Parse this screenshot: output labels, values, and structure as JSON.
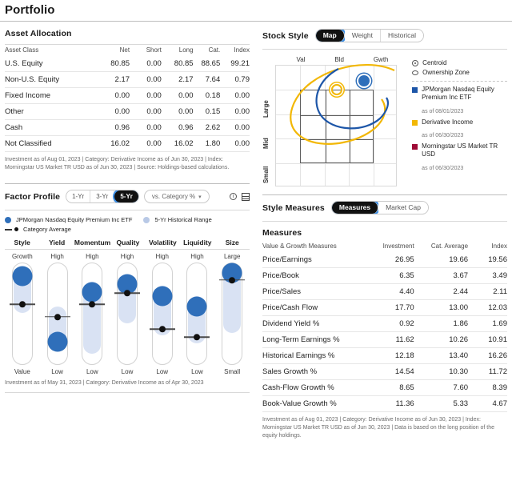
{
  "page": {
    "title": "Portfolio"
  },
  "asset_allocation": {
    "title": "Asset Allocation",
    "columns": [
      "Asset Class",
      "Net",
      "Short",
      "Long",
      "Cat.",
      "Index"
    ],
    "rows": [
      {
        "label": "U.S. Equity",
        "net": "80.85",
        "short": "0.00",
        "long": "80.85",
        "cat": "88.65",
        "index": "99.21"
      },
      {
        "label": "Non-U.S. Equity",
        "net": "2.17",
        "short": "0.00",
        "long": "2.17",
        "cat": "7.64",
        "index": "0.79"
      },
      {
        "label": "Fixed Income",
        "net": "0.00",
        "short": "0.00",
        "long": "0.00",
        "cat": "0.18",
        "index": "0.00"
      },
      {
        "label": "Other",
        "net": "0.00",
        "short": "0.00",
        "long": "0.00",
        "cat": "0.15",
        "index": "0.00"
      },
      {
        "label": "Cash",
        "net": "0.96",
        "short": "0.00",
        "long": "0.96",
        "cat": "2.62",
        "index": "0.00"
      },
      {
        "label": "Not Classified",
        "net": "16.02",
        "short": "0.00",
        "long": "16.02",
        "cat": "1.80",
        "index": "0.00"
      }
    ],
    "footnote": "Investment as of Aug 01, 2023 | Category: Derivative Income as of Jun 30, 2023 | Index: Morningstar US Market TR USD as of Jun 30, 2023 | Source: Holdings-based calculations."
  },
  "stock_style": {
    "title": "Stock Style",
    "tabs": [
      {
        "label": "Map",
        "selected": true
      },
      {
        "label": "Weight",
        "selected": false
      },
      {
        "label": "Historical",
        "selected": false
      }
    ],
    "x_axis": [
      "Val",
      "Bld",
      "Gwth"
    ],
    "y_axis": [
      "Large",
      "Mid",
      "Small"
    ],
    "legend_markers": [
      {
        "label": "Centroid",
        "marker": "centroid-icon"
      },
      {
        "label": "Ownership Zone",
        "marker": "ownership-zone-icon"
      }
    ],
    "legend_series": [
      {
        "label": "JPMorgan Nasdaq Equity Premium Inc ETF",
        "asof": "as of 08/01/2023",
        "color": "#1d56a8"
      },
      {
        "label": "Derivative Income",
        "asof": "as of 06/30/2023",
        "color": "#f2b705"
      },
      {
        "label": "Morningstar US Market TR USD",
        "asof": "as of 06/30/2023",
        "color": "#9e0b36"
      }
    ]
  },
  "factor_profile": {
    "title": "Factor Profile",
    "tabs": [
      {
        "label": "1-Yr",
        "selected": false
      },
      {
        "label": "3-Yr",
        "selected": false
      },
      {
        "label": "5-Yr",
        "selected": true
      }
    ],
    "dropdown": "vs. Category %",
    "info_icon": "info-icon",
    "table_icon": "table-view-icon",
    "legend": [
      {
        "label": "JPMorgan Nasdaq Equity Premium Inc ETF",
        "color": "#2f6fba"
      },
      {
        "label": "5-Yr Historical Range",
        "color": "#b9c9e6"
      },
      {
        "label": "Category Average",
        "color": "#111111"
      }
    ],
    "footnote": "Investment as of May 31, 2023 | Category: Derivative Income as of Apr 30, 2023",
    "chart_data": {
      "type": "bar",
      "title": "Factor Profile",
      "categories": [
        "Style",
        "Yield",
        "Momentum",
        "Quality",
        "Volatility",
        "Liquidity",
        "Size"
      ],
      "top_labels": [
        "Growth",
        "High",
        "High",
        "High",
        "High",
        "High",
        "Large"
      ],
      "bottom_labels": [
        "Value",
        "Low",
        "Low",
        "Low",
        "Low",
        "Low",
        "Small"
      ],
      "ylim": [
        0,
        100
      ],
      "series": [
        {
          "name": "JPMorgan Nasdaq Equity Premium Inc ETF",
          "values": [
            88,
            24,
            72,
            80,
            68,
            58,
            91
          ]
        },
        {
          "name": "Category Average",
          "values": [
            60,
            48,
            60,
            71,
            36,
            28,
            84
          ]
        }
      ],
      "range_bands": [
        {
          "name": "Style",
          "low": 52,
          "high": 94
        },
        {
          "name": "Yield",
          "low": 18,
          "high": 58
        },
        {
          "name": "Momentum",
          "low": 12,
          "high": 82
        },
        {
          "name": "Quality",
          "low": 42,
          "high": 88
        },
        {
          "name": "Volatility",
          "low": 30,
          "high": 78
        },
        {
          "name": "Liquidity",
          "low": 22,
          "high": 68
        },
        {
          "name": "Size",
          "low": 32,
          "high": 93
        }
      ]
    }
  },
  "style_measures": {
    "title": "Style Measures",
    "tabs": [
      {
        "label": "Measures",
        "selected": true
      },
      {
        "label": "Market Cap",
        "selected": false
      }
    ],
    "subtitle": "Measures",
    "columns": [
      "Value & Growth Measures",
      "Investment",
      "Cat. Average",
      "Index"
    ],
    "rows": [
      {
        "label": "Price/Earnings",
        "investment": "26.95",
        "cat": "19.66",
        "index": "19.56"
      },
      {
        "label": "Price/Book",
        "investment": "6.35",
        "cat": "3.67",
        "index": "3.49"
      },
      {
        "label": "Price/Sales",
        "investment": "4.40",
        "cat": "2.44",
        "index": "2.11"
      },
      {
        "label": "Price/Cash Flow",
        "investment": "17.70",
        "cat": "13.00",
        "index": "12.03"
      },
      {
        "label": "Dividend Yield %",
        "investment": "0.92",
        "cat": "1.86",
        "index": "1.69"
      },
      {
        "label": "Long-Term Earnings %",
        "investment": "11.62",
        "cat": "10.26",
        "index": "10.91"
      },
      {
        "label": "Historical Earnings %",
        "investment": "12.18",
        "cat": "13.40",
        "index": "16.26"
      },
      {
        "label": "Sales Growth %",
        "investment": "14.54",
        "cat": "10.30",
        "index": "11.72"
      },
      {
        "label": "Cash-Flow Growth %",
        "investment": "8.65",
        "cat": "7.60",
        "index": "8.39"
      },
      {
        "label": "Book-Value Growth %",
        "investment": "11.36",
        "cat": "5.33",
        "index": "4.67"
      }
    ],
    "footnote": "Investment as of Aug 01, 2023 | Category: Derivative Income as of Jun 30, 2023 | Index: Morningstar US Market TR USD as of Jun 30, 2023 | Data is based on the long position of the equity holdings."
  }
}
